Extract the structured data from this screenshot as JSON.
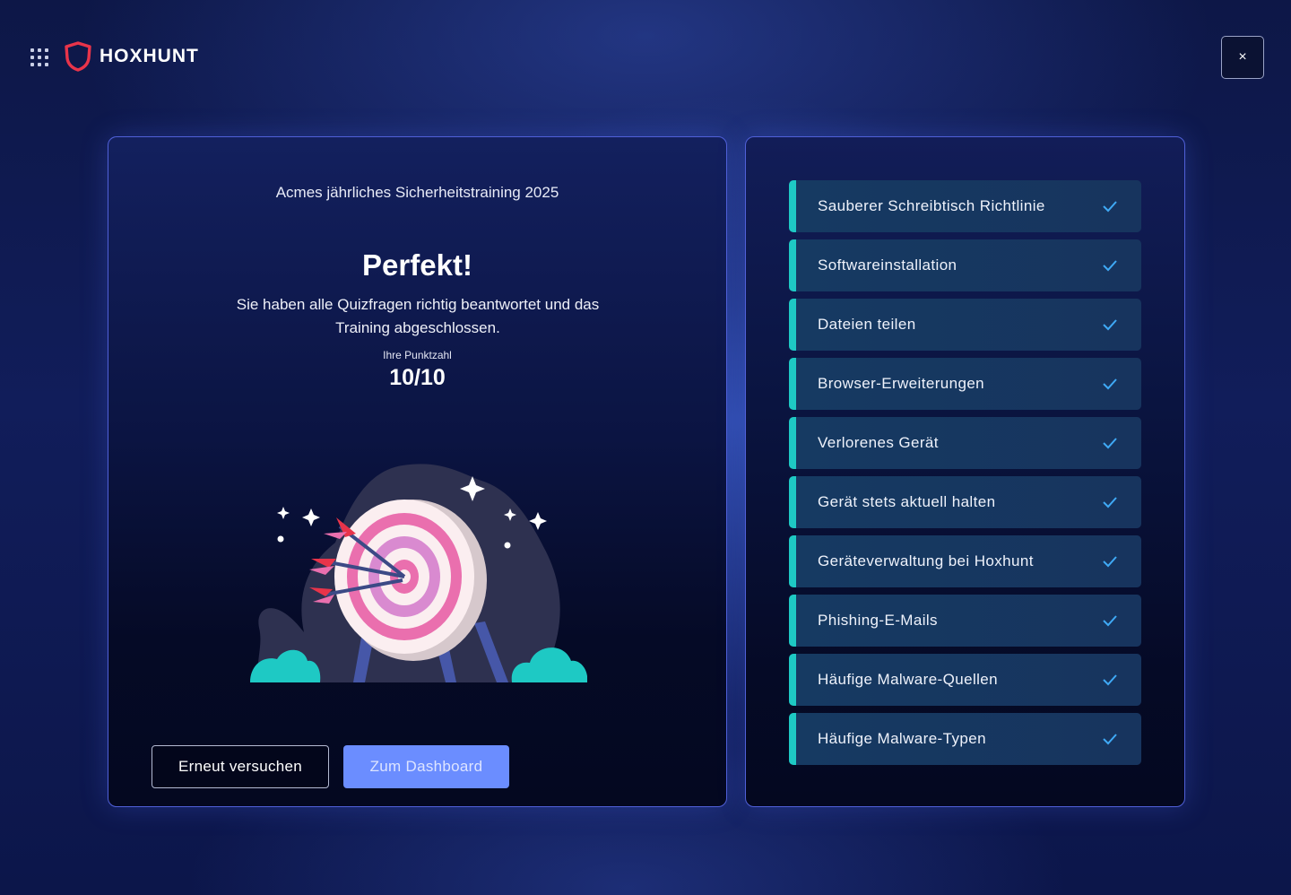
{
  "header": {
    "brand": "HOXHUNT",
    "close_label": "×"
  },
  "result": {
    "course_title": "Acmes jährliches Sicherheitstraining 2025",
    "headline": "Perfekt!",
    "message": "Sie haben alle Quizfragen richtig beantwortet und das Training abgeschlossen.",
    "score_label": "Ihre Punktzahl",
    "score_value": "10/10"
  },
  "actions": {
    "retry_label": "Erneut versuchen",
    "dashboard_label": "Zum Dashboard"
  },
  "topics": [
    {
      "label": "Sauberer Schreibtisch Richtlinie",
      "completed": true
    },
    {
      "label": "Softwareinstallation",
      "completed": true
    },
    {
      "label": "Dateien teilen",
      "completed": true
    },
    {
      "label": "Browser-Erweiterungen",
      "completed": true
    },
    {
      "label": "Verlorenes Gerät",
      "completed": true
    },
    {
      "label": "Gerät stets aktuell halten",
      "completed": true
    },
    {
      "label": "Geräteverwaltung bei Hoxhunt",
      "completed": true
    },
    {
      "label": "Phishing-E-Mails",
      "completed": true
    },
    {
      "label": "Häufige Malware-Quellen",
      "completed": true
    },
    {
      "label": "Häufige Malware-Typen",
      "completed": true
    }
  ],
  "icons": {
    "apps": "grid-icon",
    "brand": "shield-logo-icon",
    "close": "close-icon",
    "check": "check-icon",
    "illustration": "target-with-arrows"
  },
  "colors": {
    "accent": "#6b8dff",
    "topic_bar": "#1ec9c4",
    "check": "#3fa9f5",
    "logo_red": "#e8344a",
    "panel_border": "#5060d8"
  }
}
